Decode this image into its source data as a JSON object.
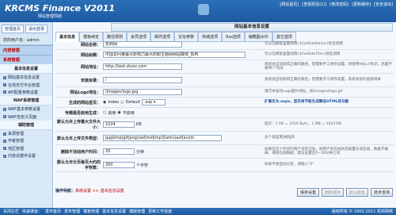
{
  "app": {
    "title": "KRCMS Finance V2011",
    "subtitle": "网站管理导航"
  },
  "toplinks": [
    "[网站首页]",
    "[查看短信(1)]",
    "[修改密码]",
    "[更新缓存]",
    "[安全退出]"
  ],
  "sidebar": {
    "btn_home": "管理首页",
    "btn_logout": "退出登录",
    "user": "您的用户名：admin",
    "sec_content": "内容管理",
    "sec_system": "系统管理",
    "sub_basic": "基本信息设置",
    "basic_items": [
      "网站基本信息设置",
      "在线支付平台管理",
      "API配置参数设置"
    ],
    "sub_waf": "WAF系统管理",
    "waf_items": [
      "WAF基本参数设置",
      "WAF自定义页面"
    ],
    "sub_aux": "辅助管理",
    "aux_items": [
      "来源管理",
      "作者管理",
      "地区管理",
      "内容关键字设置"
    ]
  },
  "panel": {
    "title": "网站基本信息设置"
  },
  "tabs": [
    "基本信息",
    "模板续定",
    "路径规则",
    "会员选项",
    "邮件选项",
    "论坛参数",
    "商城选项",
    "Rss选项",
    "缩略图水印",
    "其它选项"
  ],
  "form": [
    {
      "label": "网站名称：",
      "value": "凯邦网",
      "hint": "可以在模板里面调用{$GetSiteName}标签调用"
    },
    {
      "label": "网站标题：",
      "value": "中国访问量最大影响力最大的卸主题网网站媒体_凯邦",
      "hint": "可以在模板里面调用{$GetSiteTitle}标签调用"
    },
    {
      "label": "网站地址：",
      "value": "http://test.zkzzz.com",
      "hint": "系统会自动获得正确的路径，但需要手工保存设置。请使用http://标识，后面不要带\"/\"符号"
    },
    {
      "label": "安装目录：",
      "value": "/",
      "hint": "系统会自动获得正确的路径，但需要手工保存设置。系统安装的虚拟目录"
    },
    {
      "label": "网站Logo地址：",
      "value": "/images/logo.jpg",
      "hint": "填写本站的Logo图片地址，如/images/logo.gif"
    },
    {
      "label": "生成的网站首页：",
      "radio1": "Index",
      "radio2": "Default",
      "select": ".asp",
      "hint": "扩展名为.aspx，首页将不能生成静态HTML的功能"
    },
    {
      "label": "专题是否启用生成：",
      "radio1": "启用",
      "radio2": "不启用",
      "hint": ""
    },
    {
      "label": "默认允许上传最大文件大小：",
      "value": "1024",
      "unit": "KB",
      "hint": "提示：1 KB = 1024 Byte，1 MB = 1024 KB"
    },
    {
      "label": "默认允许上传文件类型：",
      "value": "jpg|bmp|gif|png|swf|mid|mp3|wmv|asf|avi|m",
      "hint": "多个类型用|线隔开"
    },
    {
      "label": "删除不活动用户时间：",
      "value": "20",
      "unit": "分钟",
      "hint": "如果在这个时间内用户没有活动，则用户的在线状态被置为非在线，数据不删掉，保留在线数据，建议设置在5~30分钟之间"
    },
    {
      "label": "默认允许分页每页大约的字符数：",
      "value": "200",
      "unit": "个字符",
      "hint": "如果不想自动分页，请输入\"0\""
    }
  ],
  "crumb": {
    "prefix": "操作导航：",
    "path": "系统设置 >> 基本信息设置"
  },
  "actions": [
    "保存设置",
    "刷新缓存",
    "默认数值",
    "技术咨询"
  ],
  "footer": {
    "links": [
      "关闭左栏",
      "快速通道：",
      "发布首页",
      "发布管理",
      "模板管理",
      "基本信息设置",
      "模版管理",
      "更新工作进度"
    ],
    "copyright": "版权所有 © 2002-2011 凯邦网络"
  }
}
